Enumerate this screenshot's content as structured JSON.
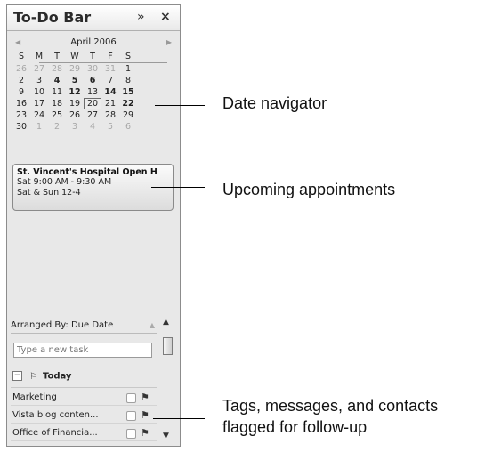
{
  "panel": {
    "title": "To-Do Bar",
    "expand_icon": "»",
    "close_icon": "×"
  },
  "date_navigator": {
    "month": "April 2006",
    "prev_icon": "◀",
    "next_icon": "▶",
    "weekdays": [
      "S",
      "M",
      "T",
      "W",
      "T",
      "F",
      "S"
    ],
    "weeks": [
      [
        {
          "d": "26",
          "other": true
        },
        {
          "d": "27",
          "other": true
        },
        {
          "d": "28",
          "other": true
        },
        {
          "d": "29",
          "other": true
        },
        {
          "d": "30",
          "other": true
        },
        {
          "d": "31",
          "other": true
        },
        {
          "d": "1"
        }
      ],
      [
        {
          "d": "2"
        },
        {
          "d": "3"
        },
        {
          "d": "4",
          "bold": true
        },
        {
          "d": "5",
          "bold": true
        },
        {
          "d": "6",
          "bold": true
        },
        {
          "d": "7"
        },
        {
          "d": "8"
        }
      ],
      [
        {
          "d": "9"
        },
        {
          "d": "10"
        },
        {
          "d": "11"
        },
        {
          "d": "12",
          "bold": true
        },
        {
          "d": "13"
        },
        {
          "d": "14",
          "bold": true
        },
        {
          "d": "15",
          "bold": true
        }
      ],
      [
        {
          "d": "16"
        },
        {
          "d": "17"
        },
        {
          "d": "18"
        },
        {
          "d": "19"
        },
        {
          "d": "20",
          "today": true
        },
        {
          "d": "21"
        },
        {
          "d": "22",
          "bold": true
        }
      ],
      [
        {
          "d": "23"
        },
        {
          "d": "24"
        },
        {
          "d": "25"
        },
        {
          "d": "26"
        },
        {
          "d": "27"
        },
        {
          "d": "28"
        },
        {
          "d": "29"
        }
      ],
      [
        {
          "d": "30"
        },
        {
          "d": "1",
          "other": true
        },
        {
          "d": "2",
          "other": true
        },
        {
          "d": "3",
          "other": true
        },
        {
          "d": "4",
          "other": true
        },
        {
          "d": "5",
          "other": true
        },
        {
          "d": "6",
          "other": true
        }
      ]
    ]
  },
  "appointment": {
    "title": "St. Vincent's Hospital Open H",
    "time": "Sat 9:00 AM - 9:30 AM",
    "note": "Sat & Sun 12-4"
  },
  "tasks": {
    "arranged_by": "Arranged By: Due Date",
    "new_task_placeholder": "Type a new task",
    "group_label": "Today",
    "items": [
      {
        "label": "Marketing"
      },
      {
        "label": "Vista blog conten..."
      },
      {
        "label": "Office of Financia..."
      }
    ]
  },
  "callouts": {
    "date_navigator": "Date navigator",
    "upcoming": "Upcoming appointments",
    "flagged_line1": "Tags, messages, and contacts",
    "flagged_line2": "flagged for follow-up"
  }
}
